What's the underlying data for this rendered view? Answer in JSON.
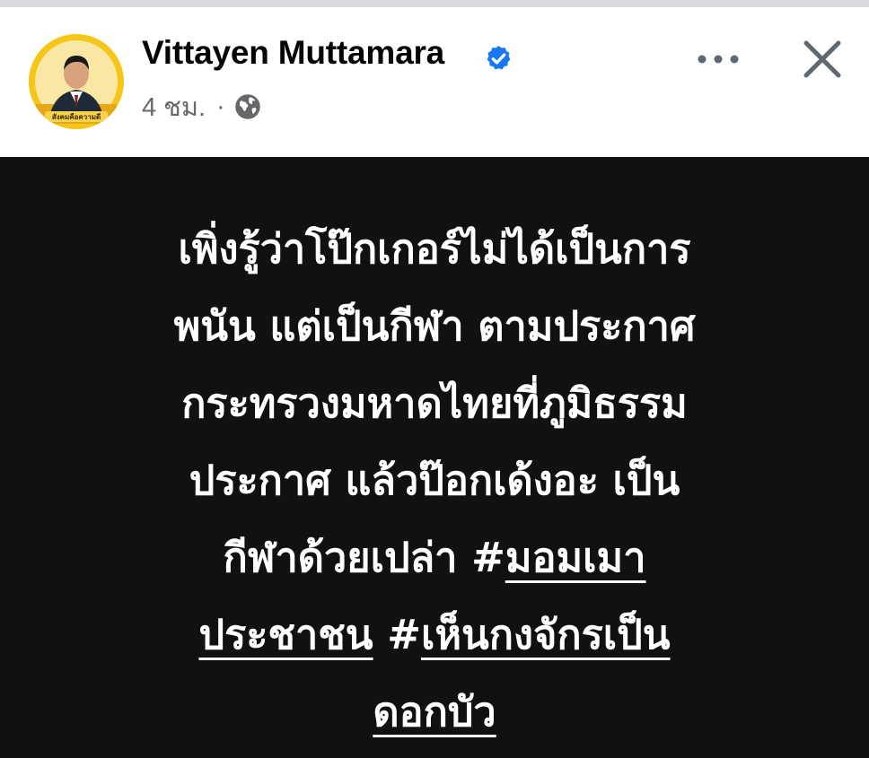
{
  "post": {
    "author": {
      "name": "Vittayen Muttamara",
      "verified": true,
      "avatar_color": "#f3c11a",
      "avatar_caption": "สังคมคือความดี"
    },
    "timestamp": "4 ชม.",
    "separator": "·",
    "audience_icon": "globe-icon",
    "actions": {
      "more_icon": "ellipsis-icon",
      "close_icon": "close-icon"
    },
    "body_background": "#111111",
    "text": {
      "line1": "เพิ่งรู้ว่าโป๊กเกอร์ไม่ได้เป็นการ",
      "line2": "พนัน แต่เป็นกีฬา ตามประกาศ",
      "line3": "กระทรวงมหาดไทยที่ภูมิธรรม",
      "line4": "ประกาศ แล้วป๊อกเด้งอะ เป็น",
      "line5_prefix": "กีฬาด้วยเปล่า ",
      "hashtag1_symbol": "#",
      "hashtag1_part1": "มอมเมา",
      "hashtag1_part2": "ประชาชน",
      "space": " ",
      "hashtag2_symbol": "#",
      "hashtag2_part1": "เห็นกงจักรเป็น",
      "hashtag2_part2": "ดอกบัว"
    }
  },
  "colors": {
    "name": "#050505",
    "meta": "#65676b",
    "verified_blue": "#1877f2",
    "text_white": "#ffffff"
  }
}
